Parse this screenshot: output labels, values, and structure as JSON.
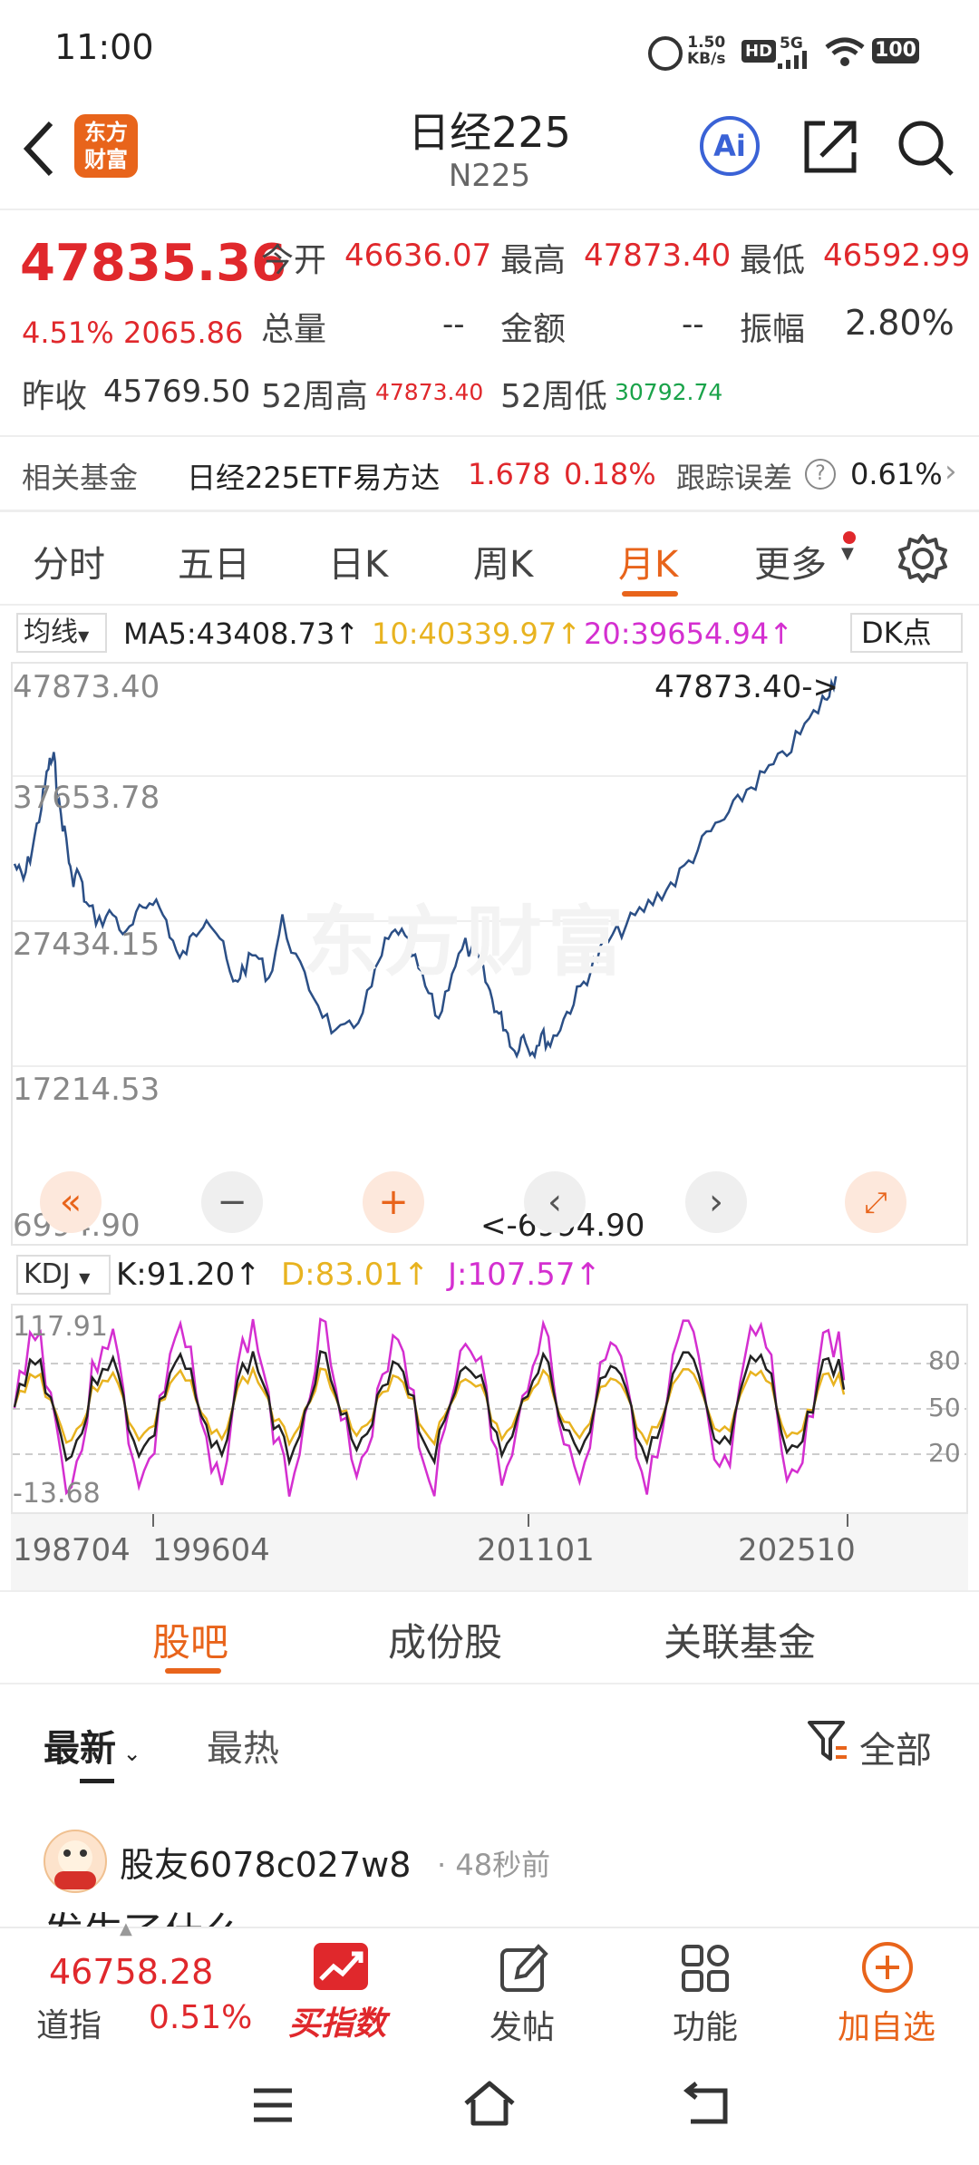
{
  "status": {
    "time": "11:00",
    "net_speed": "1.50",
    "net_unit": "KB/s",
    "hd": "HD",
    "sig": "5G",
    "battery": "100"
  },
  "header": {
    "logo_line1": "东方",
    "logo_line2": "财富",
    "title": "日经225",
    "code": "N225",
    "ai_label": "Ai"
  },
  "quote": {
    "price": "47835.36",
    "change_pct": "4.51%",
    "change": "2065.86",
    "open_label": "今开",
    "open": "46636.07",
    "high_label": "最高",
    "high": "47873.40",
    "low_label": "最低",
    "low": "46592.99",
    "vol_label": "总量",
    "vol": "--",
    "amount_label": "金额",
    "amount": "--",
    "amp_label": "振幅",
    "amp": "2.80%",
    "prev_label": "昨收",
    "prev": "45769.50",
    "w52h_label": "52周高",
    "w52h": "47873.40",
    "w52l_label": "52周低",
    "w52l": "30792.74"
  },
  "fund": {
    "label": "相关基金",
    "name": "日经225ETF易方达",
    "price": "1.678",
    "pct": "0.18%",
    "track_label": "跟踪误差",
    "track": "0.61%"
  },
  "tabs": [
    "分时",
    "五日",
    "日K",
    "周K",
    "月K",
    "更多"
  ],
  "ma": {
    "label": "均线",
    "ma5": "MA5:43408.73↑",
    "ma10": "10:40339.97↑",
    "ma20": "20:39654.94↑",
    "dk": "DK点"
  },
  "chart": {
    "yticks": [
      "47873.40",
      "37653.78",
      "27434.15",
      "17214.53",
      "6994.90"
    ],
    "max_note": "47873.40->",
    "min_note": "<-6994.90",
    "watermark": "东方财富",
    "xticks": [
      "198704",
      "199604",
      "201101",
      "202510"
    ]
  },
  "kdj": {
    "label": "KDJ",
    "k": "K:91.20↑",
    "d": "D:83.01↑",
    "j": "J:107.57↑",
    "top": "117.91",
    "bottom": "-13.68",
    "r80": "80",
    "r50": "50",
    "r20": "20"
  },
  "bottom_tabs": [
    "股吧",
    "成份股",
    "关联基金"
  ],
  "filter": {
    "latest": "最新",
    "hot": "最热",
    "all": "全部"
  },
  "post": {
    "user": "股友6078c027w8",
    "time": "· 48秒前",
    "text": "发生了什么"
  },
  "bottom_bar": {
    "index_value": "46758.28",
    "index_name": "道指",
    "index_pct": "0.51%",
    "buy": "买指数",
    "post": "发帖",
    "func": "功能",
    "add": "加自选"
  },
  "colors": {
    "red": "#e0282c",
    "orange": "#e8641b",
    "blue": "#2b4f86",
    "yellow": "#e8b320",
    "magenta": "#d42fd0"
  }
}
